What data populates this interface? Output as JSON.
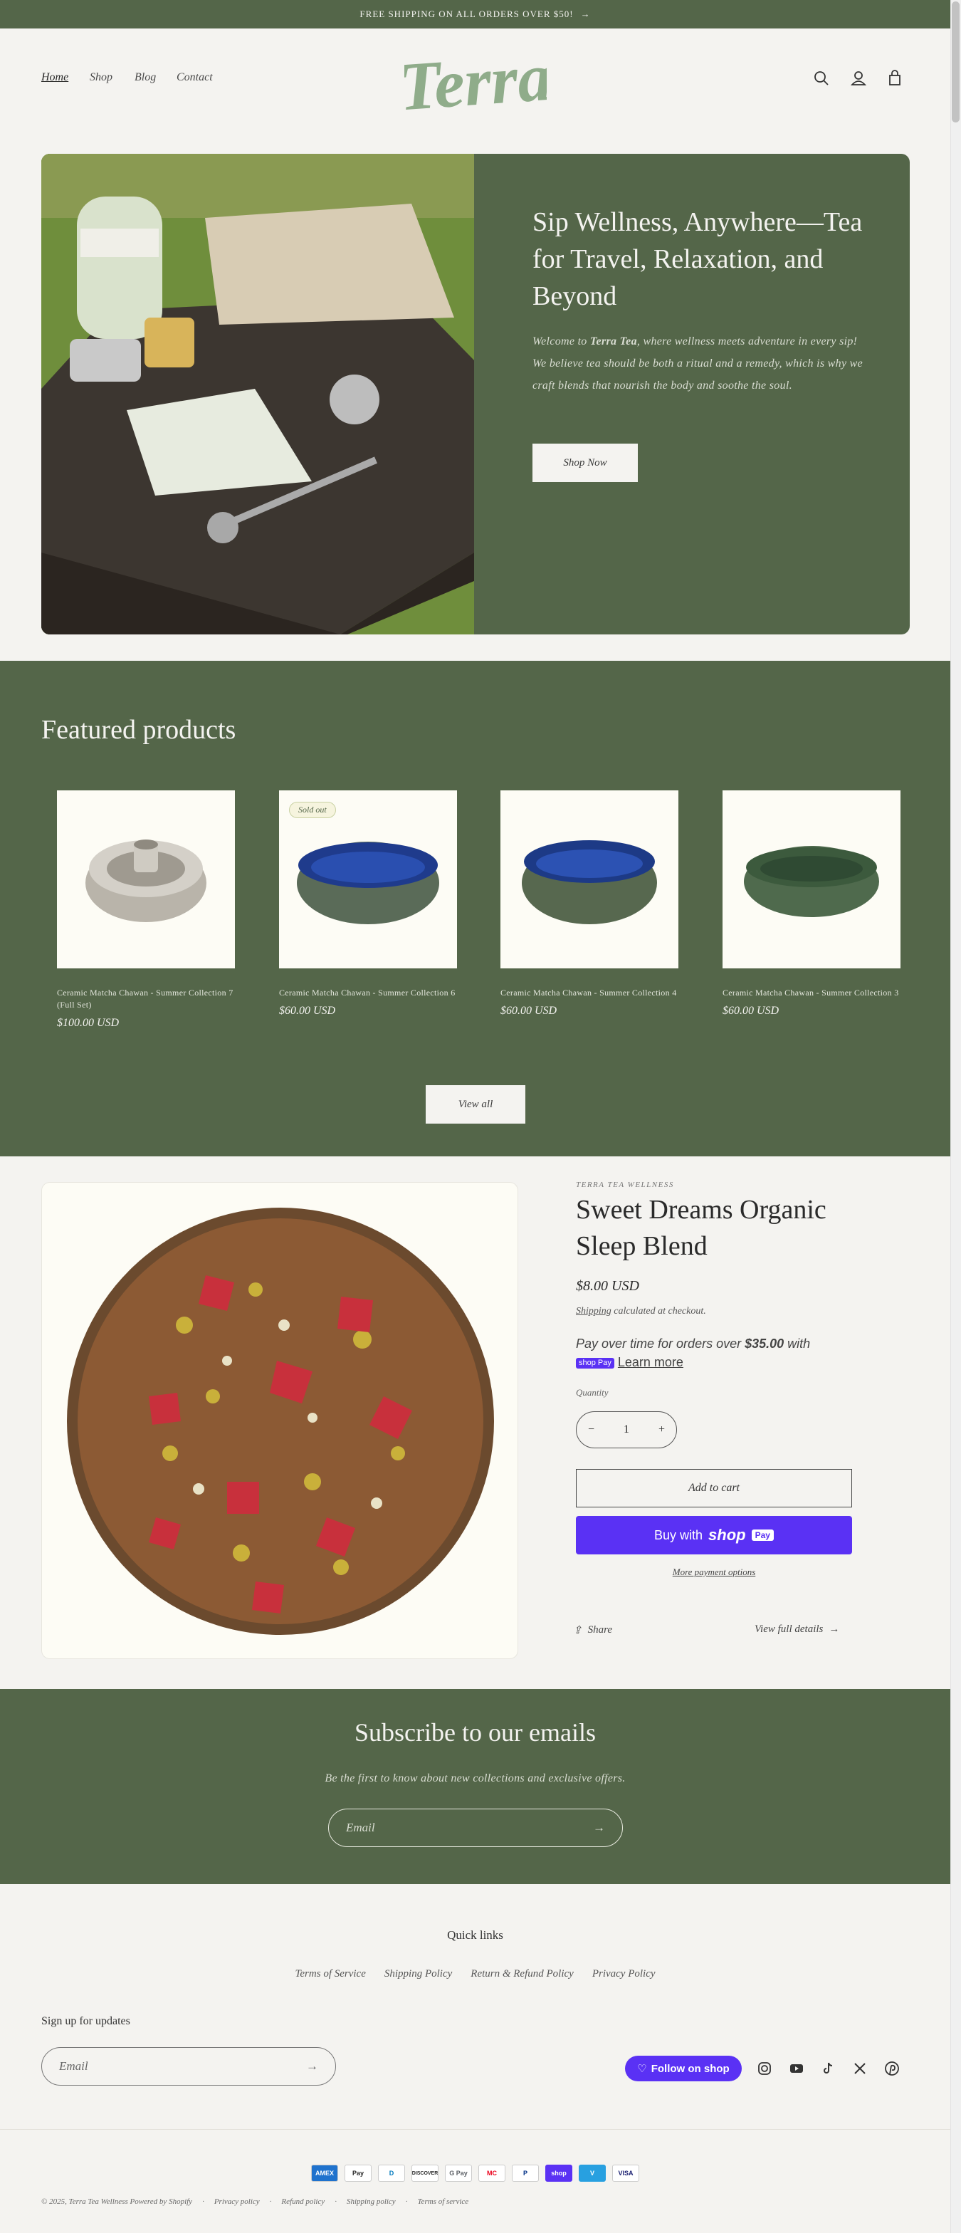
{
  "announcement": {
    "text": "FREE SHIPPING ON ALL ORDERS OVER $50!"
  },
  "header": {
    "nav": [
      {
        "label": "Home"
      },
      {
        "label": "Shop"
      },
      {
        "label": "Blog"
      },
      {
        "label": "Contact"
      }
    ],
    "logo_text": "Terra"
  },
  "hero": {
    "title": "Sip Wellness, Anywhere—Tea for Travel, Relaxation, and Beyond",
    "text_before": "Welcome to ",
    "text_bold": "Terra Tea",
    "text_after": ", where wellness meets adventure in every sip! We believe tea should be both a ritual and a remedy, which is why we craft blends that nourish the body and soothe the soul.",
    "button": "Shop Now"
  },
  "featured": {
    "title": "Featured products",
    "products": [
      {
        "name": "Ceramic Matcha Chawan - Summer Collection 7 (Full Set)",
        "price": "$100.00 USD",
        "badge": ""
      },
      {
        "name": "Ceramic Matcha Chawan - Summer Collection 6",
        "price": "$60.00 USD",
        "badge": "Sold out"
      },
      {
        "name": "Ceramic Matcha Chawan - Summer Collection 4",
        "price": "$60.00 USD",
        "badge": ""
      },
      {
        "name": "Ceramic Matcha Chawan - Summer Collection 3",
        "price": "$60.00 USD",
        "badge": ""
      }
    ],
    "view_all": "View all"
  },
  "product": {
    "vendor": "TERRA TEA WELLNESS",
    "title": "Sweet Dreams Organic Sleep Blend",
    "price": "$8.00 USD",
    "shipping_link": "Shipping",
    "shipping_rest": " calculated at checkout.",
    "pay_text_1": "Pay over time for orders over ",
    "pay_amount": "$35.00",
    "pay_text_2": " with",
    "shop_pay_badge": "shop Pay",
    "learn_more": "Learn more",
    "quantity_label": "Quantity",
    "quantity": "1",
    "add_to_cart": "Add to cart",
    "buy_with": "Buy with",
    "buy_brand": "shop",
    "buy_pay": "Pay",
    "more_options": "More payment options",
    "share": "Share",
    "view_full": "View full details"
  },
  "subscribe": {
    "title": "Subscribe to our emails",
    "text": "Be the first to know about new collections and exclusive offers.",
    "placeholder": "Email"
  },
  "footer": {
    "quick_links_title": "Quick links",
    "links": [
      {
        "label": "Terms of Service"
      },
      {
        "label": "Shipping Policy"
      },
      {
        "label": "Return & Refund Policy"
      },
      {
        "label": "Privacy Policy"
      }
    ],
    "signup_title": "Sign up for updates",
    "email_placeholder": "Email",
    "follow": "Follow on shop",
    "payments": [
      "AMEX",
      "Pay",
      "D",
      "DISCOVER",
      "G Pay",
      "MC",
      "P",
      "shop",
      "V",
      "VISA"
    ],
    "copyright": "© 2025, Terra Tea Wellness Powered by Shopify",
    "legal": [
      "Privacy policy",
      "Refund policy",
      "Shipping policy",
      "Terms of service"
    ]
  },
  "colors": {
    "accent": "#546649",
    "background": "#f4f3f0",
    "shop_pay": "#5a31f4",
    "logo": "#8fac8a"
  }
}
